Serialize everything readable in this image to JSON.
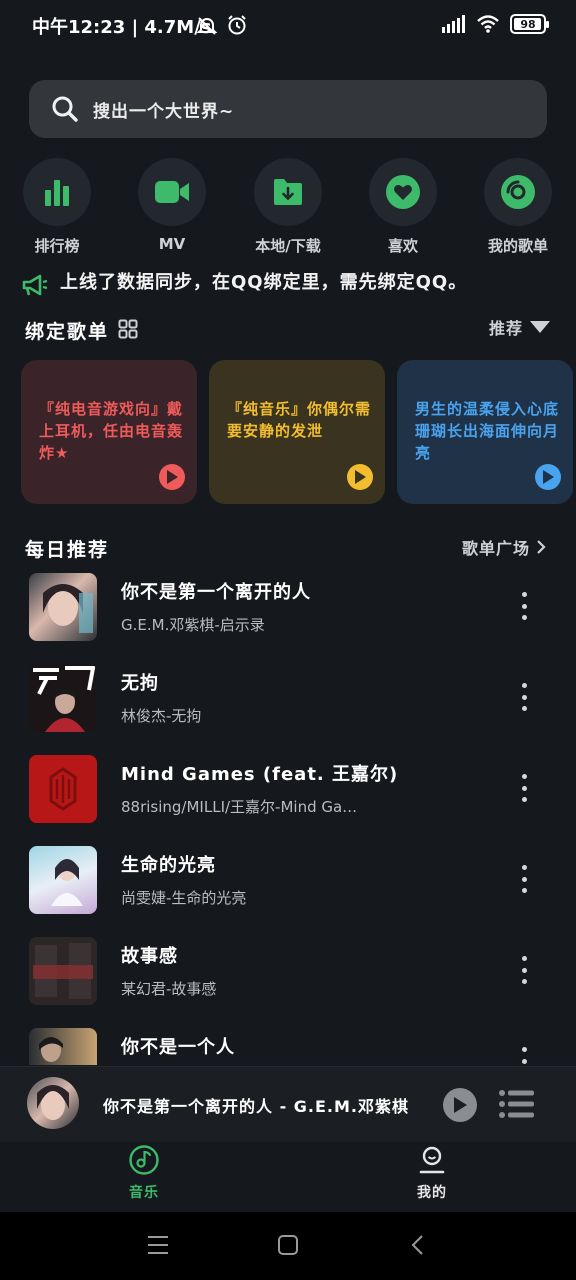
{
  "status_bar": {
    "time": "中午12:23",
    "speed": "4.7M/s",
    "battery": "98",
    "battery_level": 0.98
  },
  "search": {
    "placeholder": "搜出一个大世界~"
  },
  "quick_nav": [
    {
      "label": "排行榜",
      "icon": "chart-bars-icon"
    },
    {
      "label": "MV",
      "icon": "video-camera-icon"
    },
    {
      "label": "本地/下载",
      "icon": "folder-download-icon"
    },
    {
      "label": "喜欢",
      "icon": "heart-icon"
    },
    {
      "label": "我的歌单",
      "icon": "disc-icon"
    }
  ],
  "notice": {
    "text": "上线了数据同步，在QQ绑定里，需先绑定QQ。"
  },
  "bound_playlists": {
    "title": "绑定歌单",
    "sort_label": "推荐",
    "cards": [
      {
        "text": "『纯电音游戏向』戴上耳机，任由电音轰炸★",
        "bg": "#3a2329",
        "fg": "#ef5a5a",
        "accent": "#ef5a5a"
      },
      {
        "text": "『纯音乐』你偶尔需要安静的发泄",
        "bg": "#3a3320",
        "fg": "#f2bd2e",
        "accent": "#f2bd2e"
      },
      {
        "text": "男生的温柔侵入心底 珊瑚长出海面伸向月亮",
        "bg": "#1f3248",
        "fg": "#4aa3ee",
        "accent": "#4aa3ee"
      }
    ]
  },
  "daily": {
    "title": "每日推荐",
    "more_label": "歌单广场",
    "songs": [
      {
        "title": "你不是第一个离开的人",
        "sub": "G.E.M.邓紫棋-启示录"
      },
      {
        "title": "无拘",
        "sub": "林俊杰-无拘"
      },
      {
        "title": "Mind Games (feat. 王嘉尔)",
        "sub": "88rising/MILLI/王嘉尔-Mind Ga…"
      },
      {
        "title": "生命的光亮",
        "sub": "尚雯婕-生命的光亮"
      },
      {
        "title": "故事感",
        "sub": "某幻君-故事感"
      },
      {
        "title": "你不是一个人",
        "sub": ""
      }
    ]
  },
  "player": {
    "now_playing": "你不是第一个离开的人 - G.E.M.邓紫棋"
  },
  "tabs": [
    {
      "label": "音乐",
      "active": true
    },
    {
      "label": "我的",
      "active": false
    }
  ],
  "colors": {
    "accent": "#3dba6a",
    "background": "#15181d"
  }
}
